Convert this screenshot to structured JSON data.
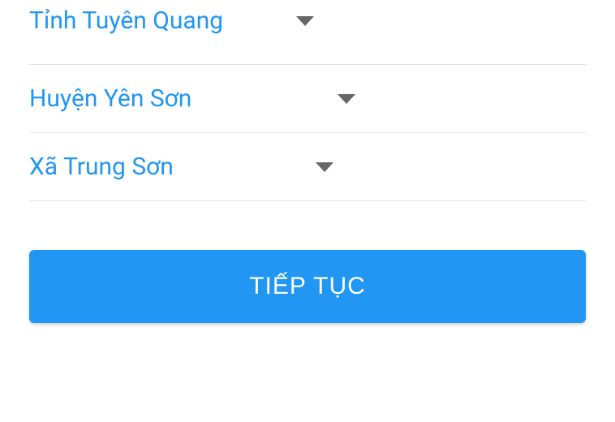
{
  "dropdowns": {
    "province": {
      "value": "Tỉnh Tuyên Quang"
    },
    "district": {
      "value": "Huyện Yên Sơn"
    },
    "commune": {
      "value": "Xã Trung Sơn"
    }
  },
  "button": {
    "continue_label": "TIẾP TỤC"
  }
}
